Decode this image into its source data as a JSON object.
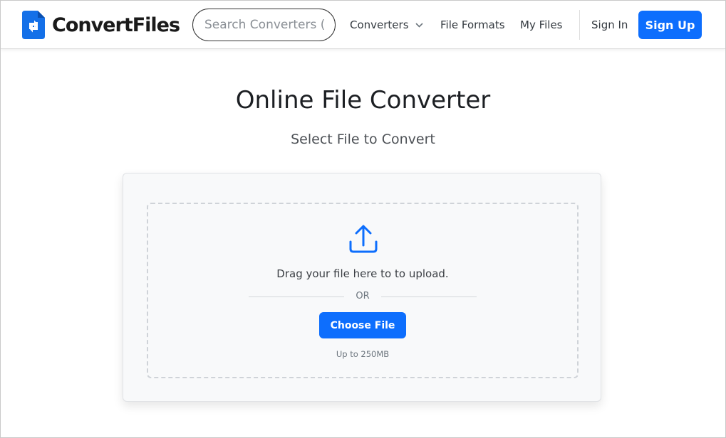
{
  "header": {
    "brand_name": "ConvertFiles",
    "logo_icon": "file-convert-logo-icon",
    "search_placeholder": "Search Converters (e.g. PDF to Word)",
    "nav": {
      "converters": "Converters",
      "file_formats": "File Formats",
      "my_files": "My Files"
    },
    "sign_in": "Sign In",
    "sign_up": "Sign Up"
  },
  "main": {
    "title": "Online File Converter",
    "subtitle": "Select File to Convert",
    "upload": {
      "icon": "upload-icon",
      "drag_text": "Drag your file here to to upload.",
      "or_text": "OR",
      "choose_button": "Choose File",
      "limit_text": "Up to 250MB"
    }
  },
  "colors": {
    "accent": "#0d6efd",
    "text_dark": "#1c1f23",
    "card_bg": "#f8f9fa"
  }
}
